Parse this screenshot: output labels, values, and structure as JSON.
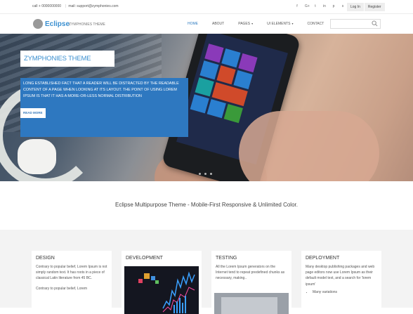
{
  "topbar": {
    "phone": "call + 0000000000",
    "email": "mail: support@zymphonies.com",
    "socials": [
      "f",
      "G+",
      "t",
      "in",
      "p",
      "s"
    ],
    "login": "Log In",
    "register": "Register"
  },
  "header": {
    "logo_name": "Eclipse",
    "logo_tagline": "ZYMPHONIES THEME",
    "nav": [
      "HOME",
      "ABOUT",
      "PAGES",
      "UI ELEMENTS",
      "CONTACT"
    ]
  },
  "hero": {
    "title": "ZYMPHONIES THEME",
    "text": "LONG ESTABLISHED FACT THAT A READER WILL BE DISTRACTED BY THE READABLE CONTENT OF A PAGE WHEN LOOKING AT ITS LAYOUT. THE POINT OF USING LOREM IPSUM IS THAT IT HAS A MORE-OR-LESS NORMAL DISTRIBUTION",
    "read_more": "READ MORE"
  },
  "tagline": "Eclipse Multipurpose  Theme - Mobile-First Responsive & Unlimited Color.",
  "features": [
    {
      "title": "DESIGN",
      "text1": "Contrary to popular belief, Lorem Ipsum is not simply random text. It has roots in a piece of classical Latin literature from 45 BC.",
      "text2": "Contrary to popular belief, Lorem"
    },
    {
      "title": "DEVELOPMENT"
    },
    {
      "title": "TESTING",
      "text1": "All the Lorem Ipsum generators on the Internet tend to repeat predefined chunks as necessary, making.."
    },
    {
      "title": "DEPLOYMENT",
      "text1": "Many desktop publishing packages and web page editors now use Lorem Ipsum as their default model text, and a search for 'lorem ipsum'",
      "bullet1": "Many variations"
    }
  ],
  "colors": {
    "accent": "#2e78c0",
    "logo": "#3a8fd0"
  }
}
